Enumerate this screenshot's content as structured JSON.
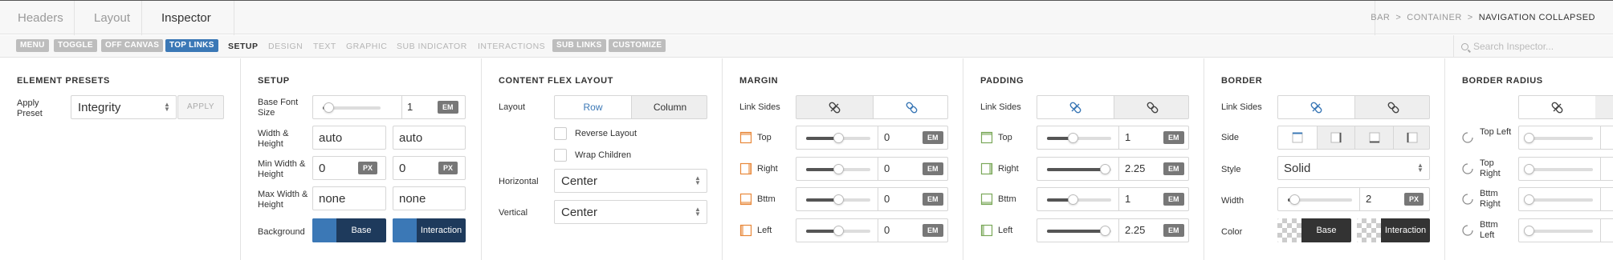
{
  "tabs": [
    {
      "label": "Headers"
    },
    {
      "label": "Layout"
    },
    {
      "label": "Inspector"
    }
  ],
  "breadcrumb": {
    "items": [
      "BAR",
      "CONTAINER"
    ],
    "current": "NAVIGATION COLLAPSED",
    "separator": ">"
  },
  "pills": [
    {
      "label": "MENU"
    },
    {
      "label": "TOGGLE"
    },
    {
      "label": "OFF CANVAS"
    },
    {
      "label": "TOP LINKS"
    }
  ],
  "subtabs": [
    {
      "label": "SETUP"
    },
    {
      "label": "DESIGN"
    },
    {
      "label": "TEXT"
    },
    {
      "label": "GRAPHIC"
    },
    {
      "label": "SUB INDICATOR"
    },
    {
      "label": "INTERACTIONS"
    }
  ],
  "subpills": [
    {
      "label": "SUB LINKS"
    },
    {
      "label": "CUSTOMIZE"
    }
  ],
  "search": {
    "placeholder": "Search Inspector..."
  },
  "colors": {
    "accent": "#3b78b6",
    "base_swatch": "#3b78b6",
    "dark_fill": "#1e3a5c",
    "unit_badge": "#777777"
  },
  "presets": {
    "title": "ELEMENT PRESETS",
    "apply_label": "Apply Preset",
    "value": "Integrity",
    "button": "APPLY"
  },
  "setup": {
    "title": "SETUP",
    "base_font": {
      "label": "Base Font Size",
      "value": "1",
      "unit": "EM",
      "slider": 0.1
    },
    "size": {
      "label": "Width & Height",
      "width": "auto",
      "height": "auto"
    },
    "min": {
      "label": "Min Width & Height",
      "width": "0",
      "height": "0",
      "unit": "PX"
    },
    "max": {
      "label": "Max Width & Height",
      "width": "none",
      "height": "none"
    },
    "background": {
      "label": "Background",
      "base": "Base",
      "interaction": "Interaction"
    }
  },
  "flex": {
    "title": "CONTENT FLEX LAYOUT",
    "layout": {
      "label": "Layout",
      "options": [
        "Row",
        "Column"
      ],
      "selected": "Row"
    },
    "reverse": "Reverse Layout",
    "wrap": "Wrap Children",
    "horizontal": {
      "label": "Horizontal",
      "value": "Center"
    },
    "vertical": {
      "label": "Vertical",
      "value": "Center"
    }
  },
  "margin": {
    "title": "MARGIN",
    "link_label": "Link Sides",
    "rows": [
      {
        "label": "Top",
        "value": "0",
        "unit": "EM",
        "slider": 0.5
      },
      {
        "label": "Right",
        "value": "0",
        "unit": "EM",
        "slider": 0.5
      },
      {
        "label": "Bttm",
        "value": "0",
        "unit": "EM",
        "slider": 0.5
      },
      {
        "label": "Left",
        "value": "0",
        "unit": "EM",
        "slider": 0.5
      }
    ]
  },
  "padding": {
    "title": "PADDING",
    "link_label": "Link Sides",
    "rows": [
      {
        "label": "Top",
        "value": "1",
        "unit": "EM",
        "slider": 0.4
      },
      {
        "label": "Right",
        "value": "2.25",
        "unit": "EM",
        "slider": 0.9
      },
      {
        "label": "Bttm",
        "value": "1",
        "unit": "EM",
        "slider": 0.4
      },
      {
        "label": "Left",
        "value": "2.25",
        "unit": "EM",
        "slider": 0.9
      }
    ]
  },
  "border": {
    "title": "BORDER",
    "link_label": "Link Sides",
    "side_label": "Side",
    "style": {
      "label": "Style",
      "value": "Solid"
    },
    "width": {
      "label": "Width",
      "value": "2",
      "unit": "PX",
      "slider": 0.1
    },
    "color": {
      "label": "Color",
      "base": "Base",
      "interaction": "Interaction"
    }
  },
  "radius": {
    "title": "BORDER RADIUS",
    "rows": [
      {
        "label": "Top Left"
      },
      {
        "label": "Top Right"
      },
      {
        "label": "Bttm Right"
      },
      {
        "label": "Bttm Left"
      }
    ]
  }
}
